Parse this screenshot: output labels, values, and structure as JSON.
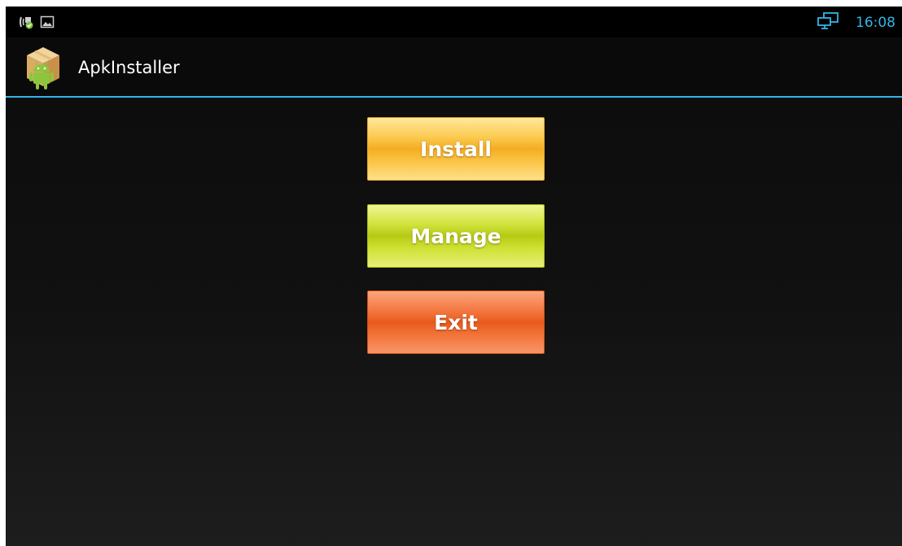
{
  "status_bar": {
    "left_icons": [
      "call-forwarding-icon",
      "image-notification-icon"
    ],
    "right_icons": [
      "connected-display-icon"
    ],
    "time": "16:08"
  },
  "action_bar": {
    "title": "ApkInstaller",
    "icon": "android-package-icon"
  },
  "buttons": {
    "install_label": "Install",
    "manage_label": "Manage",
    "exit_label": "Exit"
  },
  "colors": {
    "accent": "#33b5e5",
    "install": "#f4ad22",
    "manage": "#b6ca14",
    "exit": "#e85a1c"
  }
}
